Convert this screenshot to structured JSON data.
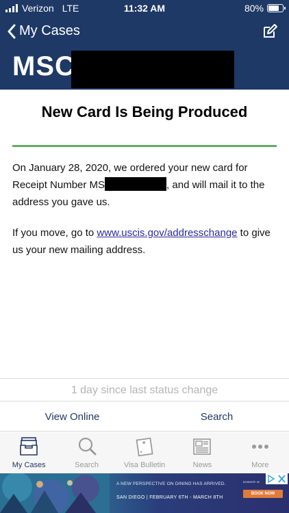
{
  "status_bar": {
    "carrier": "Verizon",
    "network": "LTE",
    "time": "11:32 AM",
    "battery": "80%",
    "battery_level": 0.8
  },
  "nav": {
    "back_label": "My Cases",
    "edit_icon": "edit-icon"
  },
  "case": {
    "receipt_prefix": "MSC"
  },
  "status": {
    "title": "New Card Is Being Produced",
    "p1_a": "On January 28, 2020, we ordered your new card for Receipt Number MS",
    "p1_b": ", and will mail it to the address you gave us.",
    "p2_a": "If you move, go to ",
    "p2_link": "www.uscis.gov/addresschange",
    "p2_b": " to give us your new mailing address."
  },
  "since": "1 day since last status change",
  "actions": {
    "view_online": "View Online",
    "search": "Search"
  },
  "tabs": [
    {
      "label": "My Cases",
      "icon": "inbox-icon",
      "active": true
    },
    {
      "label": "Search",
      "icon": "search-icon",
      "active": false
    },
    {
      "label": "Visa Bulletin",
      "icon": "bulletin-icon",
      "active": false
    },
    {
      "label": "News",
      "icon": "news-icon",
      "active": false
    },
    {
      "label": "More",
      "icon": "more-icon",
      "active": false
    }
  ],
  "ad": {
    "line1": "A NEW PERSPECTIVE ON DINING HAS ARRIVED.",
    "line2": "SAN DIEGO  |  FEBRUARY 6TH - MARCH 8TH",
    "brand": "DINNER W",
    "button": "BOOK NOW"
  },
  "colors": {
    "header": "#1e3966",
    "divider": "#5fad62",
    "link": "#2a2aa0",
    "ad_button": "#e07b3c"
  }
}
